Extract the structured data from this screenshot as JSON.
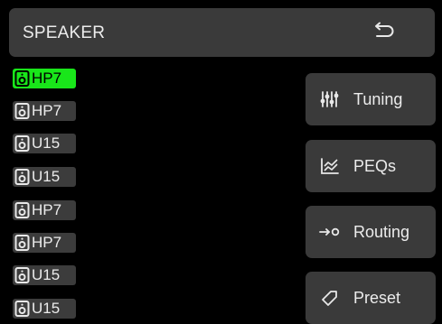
{
  "header": {
    "title": "SPEAKER",
    "back_icon": "return-arrow-icon"
  },
  "speakers": [
    {
      "label": "HP7",
      "active": true
    },
    {
      "label": "HP7",
      "active": false
    },
    {
      "label": "U15",
      "active": false
    },
    {
      "label": "U15",
      "active": false
    },
    {
      "label": "HP7",
      "active": false
    },
    {
      "label": "HP7",
      "active": false
    },
    {
      "label": "U15",
      "active": false
    },
    {
      "label": "U15",
      "active": false
    }
  ],
  "menu": [
    {
      "label": "Tuning",
      "icon": "sliders-icon"
    },
    {
      "label": "PEQs",
      "icon": "chart-icon"
    },
    {
      "label": "Routing",
      "icon": "routing-arrow-icon"
    },
    {
      "label": "Preset",
      "icon": "tag-icon"
    }
  ],
  "colors": {
    "active": "#19e61a",
    "panel": "#3a3a3a",
    "background": "#000000"
  }
}
